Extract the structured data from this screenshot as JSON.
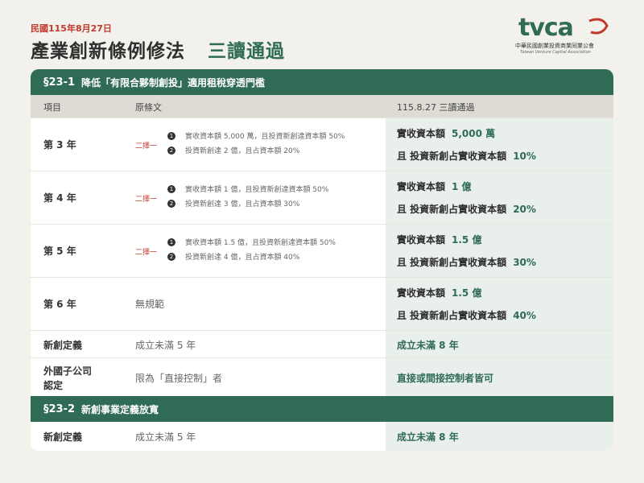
{
  "header": {
    "date": "民國115年8月27日",
    "title": "產業創新條例修法",
    "title_highlight": "三讀通過"
  },
  "logo": {
    "mark": "tvca",
    "name_cn": "中華民國創業投資商業同業公會",
    "name_en": "Taiwan Venture Capital Association"
  },
  "section1": {
    "number": "§23-1",
    "title": "降低「有限合夥制創投」適用租稅穿透門檻",
    "columns": {
      "item": "項目",
      "original": "原條文",
      "new": "115.8.27 三讀通過"
    },
    "rows": [
      {
        "item": "第 3 年",
        "choose": "二擇一",
        "options": [
          {
            "bullet": "1",
            "text": "實收資本額 5,000 萬，且投資新創達資本額 50%"
          },
          {
            "bullet": "2",
            "text": "投資新創達 2 億，且占資本額 20%"
          }
        ],
        "new_lines": [
          {
            "label": "實收資本額",
            "value": "5,000 萬"
          },
          {
            "label": "且 投資新創占實收資本額",
            "value": "10%"
          }
        ]
      },
      {
        "item": "第 4 年",
        "choose": "二擇一",
        "options": [
          {
            "bullet": "1",
            "text": "實收資本額 1 億，且投資新創達資本額 50%"
          },
          {
            "bullet": "2",
            "text": "投資新創達 3 億，且占資本額 30%"
          }
        ],
        "new_lines": [
          {
            "label": "實收資本額",
            "value": "1 億"
          },
          {
            "label": "且 投資新創占實收資本額",
            "value": "20%"
          }
        ]
      },
      {
        "item": "第 5 年",
        "choose": "二擇一",
        "options": [
          {
            "bullet": "1",
            "text": "實收資本額 1.5 億，且投資新創達資本額 50%"
          },
          {
            "bullet": "2",
            "text": "投資新創達 4 億，且占資本額 40%"
          }
        ],
        "new_lines": [
          {
            "label": "實收資本額",
            "value": "1.5 億"
          },
          {
            "label": "且 投資新創占實收資本額",
            "value": "30%"
          }
        ]
      },
      {
        "item": "第 6 年",
        "original": "無規範",
        "new_lines": [
          {
            "label": "實收資本額",
            "value": "1.5 億"
          },
          {
            "label": "且 投資新創占實收資本額",
            "value": "40%"
          }
        ]
      }
    ],
    "startup_def": {
      "item": "新創定義",
      "original": "成立未滿 5 年",
      "new": "成立未滿 8 年"
    },
    "foreign_sub": {
      "item_line1": "外國子公司",
      "item_line2": "認定",
      "original": "限為「直接控制」者",
      "new": "直接或間接控制者皆可"
    }
  },
  "section2": {
    "number": "§23-2",
    "title": "新創事業定義放寬",
    "row": {
      "item": "新創定義",
      "original": "成立未滿 5 年",
      "new": "成立未滿 8 年"
    }
  },
  "colors": {
    "accent": "#2f6b55",
    "choose": "#c0392b",
    "header_bg": "#dddbd3",
    "new_bg": "#e9efeb"
  }
}
